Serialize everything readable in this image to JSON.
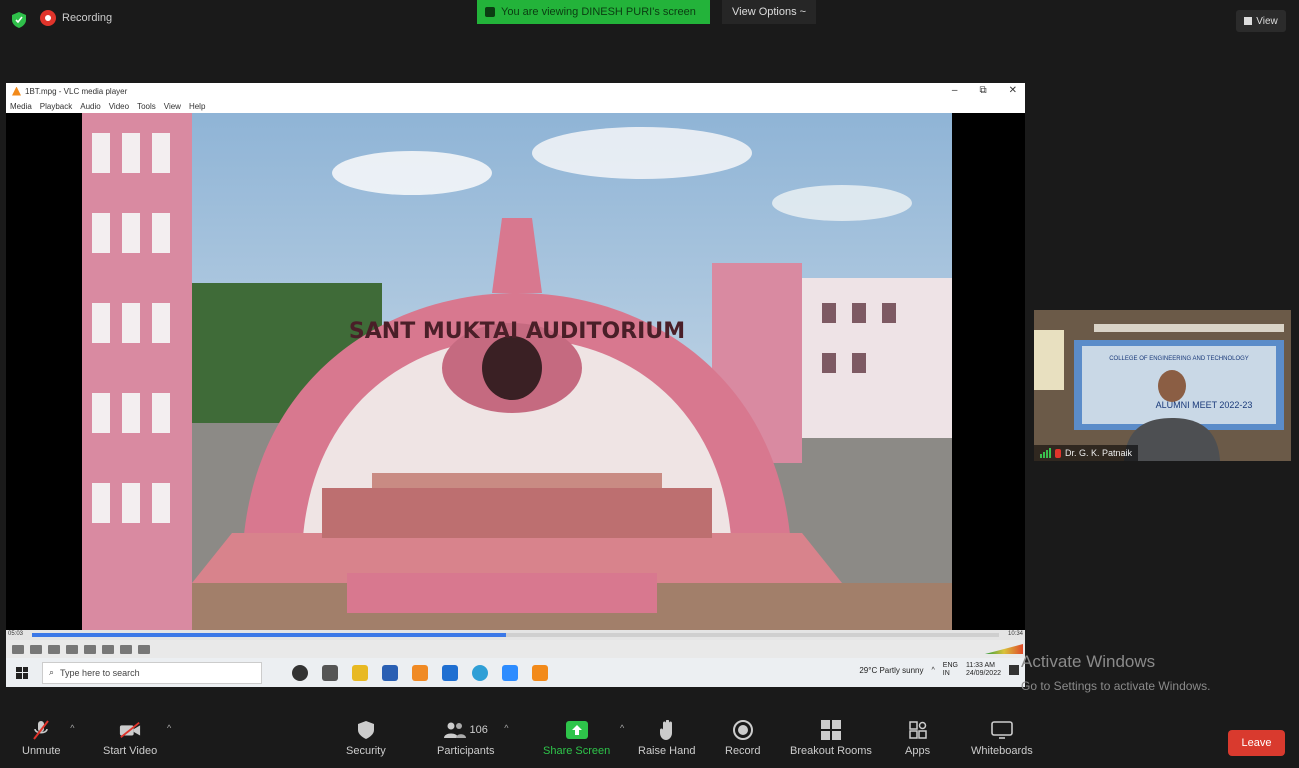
{
  "topbar": {
    "recording_label": "Recording",
    "viewing_banner": "You are viewing DINESH PURI's screen",
    "view_options": "View Options ~",
    "view_button": "View"
  },
  "vlc": {
    "title": "1BT.mpg - VLC media player",
    "menu": [
      "Media",
      "Playback",
      "Audio",
      "Video",
      "Tools",
      "View",
      "Help"
    ],
    "window_controls": [
      "–",
      "⧉",
      "✕"
    ],
    "time_elapsed": "05:03",
    "time_total": "10:34",
    "progress": 0.49,
    "video_sign_text": "SANT MUKTAI AUDITORIUM"
  },
  "taskbar": {
    "search_placeholder": "Type here to search",
    "weather": "29°C  Partly sunny",
    "lang_top": "ENG",
    "lang_bottom": "IN",
    "time": "11:33 AM",
    "date": "24/09/2022"
  },
  "participant": {
    "name": "Dr. G. K. Patnaik",
    "banner_line1": "COLLEGE OF ENGINEERING AND TECHNOLOGY",
    "banner_line2": "ALUMNI MEET 2022-23"
  },
  "watermark": {
    "title": "Activate Windows",
    "subtitle": "Go to Settings to activate Windows."
  },
  "toolbar": {
    "unmute": "Unmute",
    "start_video": "Start Video",
    "security": "Security",
    "participants": "Participants",
    "participants_count": "106",
    "share_screen": "Share Screen",
    "raise_hand": "Raise Hand",
    "record": "Record",
    "breakout_rooms": "Breakout Rooms",
    "apps": "Apps",
    "whiteboards": "Whiteboards",
    "leave": "Leave"
  }
}
